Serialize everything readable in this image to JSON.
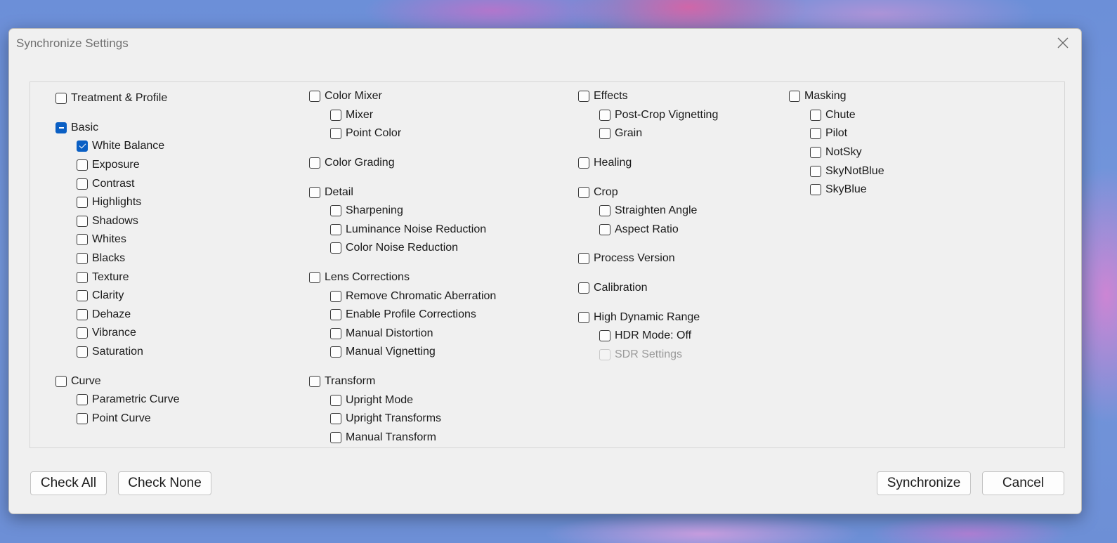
{
  "dialog": {
    "title": "Synchronize Settings",
    "close_icon": "close-icon"
  },
  "columns": [
    [
      {
        "label": "Treatment & Profile",
        "level": 0,
        "state": "unchecked"
      },
      {
        "gap": true
      },
      {
        "label": "Basic",
        "level": 0,
        "state": "mixed"
      },
      {
        "label": "White Balance",
        "level": 1,
        "state": "checked"
      },
      {
        "label": "Exposure",
        "level": 1,
        "state": "unchecked"
      },
      {
        "label": "Contrast",
        "level": 1,
        "state": "unchecked"
      },
      {
        "label": "Highlights",
        "level": 1,
        "state": "unchecked"
      },
      {
        "label": "Shadows",
        "level": 1,
        "state": "unchecked"
      },
      {
        "label": "Whites",
        "level": 1,
        "state": "unchecked"
      },
      {
        "label": "Blacks",
        "level": 1,
        "state": "unchecked"
      },
      {
        "label": "Texture",
        "level": 1,
        "state": "unchecked"
      },
      {
        "label": "Clarity",
        "level": 1,
        "state": "unchecked"
      },
      {
        "label": "Dehaze",
        "level": 1,
        "state": "unchecked"
      },
      {
        "label": "Vibrance",
        "level": 1,
        "state": "unchecked"
      },
      {
        "label": "Saturation",
        "level": 1,
        "state": "unchecked"
      },
      {
        "gap": true
      },
      {
        "label": "Curve",
        "level": 0,
        "state": "unchecked"
      },
      {
        "label": "Parametric Curve",
        "level": 1,
        "state": "unchecked"
      },
      {
        "label": "Point Curve",
        "level": 1,
        "state": "unchecked"
      }
    ],
    [
      {
        "label": "Color Mixer",
        "level": 0,
        "state": "unchecked"
      },
      {
        "label": "Mixer",
        "level": 1,
        "state": "unchecked"
      },
      {
        "label": "Point Color",
        "level": 1,
        "state": "unchecked"
      },
      {
        "gap": true
      },
      {
        "label": "Color Grading",
        "level": 0,
        "state": "unchecked"
      },
      {
        "gap": true
      },
      {
        "label": "Detail",
        "level": 0,
        "state": "unchecked"
      },
      {
        "label": "Sharpening",
        "level": 1,
        "state": "unchecked"
      },
      {
        "label": "Luminance Noise Reduction",
        "level": 1,
        "state": "unchecked"
      },
      {
        "label": "Color Noise Reduction",
        "level": 1,
        "state": "unchecked"
      },
      {
        "gap": true
      },
      {
        "label": "Lens Corrections",
        "level": 0,
        "state": "unchecked"
      },
      {
        "label": "Remove Chromatic Aberration",
        "level": 1,
        "state": "unchecked"
      },
      {
        "label": "Enable Profile Corrections",
        "level": 1,
        "state": "unchecked"
      },
      {
        "label": "Manual Distortion",
        "level": 1,
        "state": "unchecked"
      },
      {
        "label": "Manual Vignetting",
        "level": 1,
        "state": "unchecked"
      },
      {
        "gap": true
      },
      {
        "label": "Transform",
        "level": 0,
        "state": "unchecked"
      },
      {
        "label": "Upright Mode",
        "level": 1,
        "state": "unchecked"
      },
      {
        "label": "Upright Transforms",
        "level": 1,
        "state": "unchecked"
      },
      {
        "label": "Manual Transform",
        "level": 1,
        "state": "unchecked"
      }
    ],
    [
      {
        "label": "Effects",
        "level": 0,
        "state": "unchecked"
      },
      {
        "label": "Post-Crop Vignetting",
        "level": 1,
        "state": "unchecked"
      },
      {
        "label": "Grain",
        "level": 1,
        "state": "unchecked"
      },
      {
        "gap": true
      },
      {
        "label": "Healing",
        "level": 0,
        "state": "unchecked"
      },
      {
        "gap": true
      },
      {
        "label": "Crop",
        "level": 0,
        "state": "unchecked"
      },
      {
        "label": "Straighten Angle",
        "level": 1,
        "state": "unchecked"
      },
      {
        "label": "Aspect Ratio",
        "level": 1,
        "state": "unchecked"
      },
      {
        "gap": true
      },
      {
        "label": "Process Version",
        "level": 0,
        "state": "unchecked"
      },
      {
        "gap": true
      },
      {
        "label": "Calibration",
        "level": 0,
        "state": "unchecked"
      },
      {
        "gap": true
      },
      {
        "label": "High Dynamic Range",
        "level": 0,
        "state": "unchecked"
      },
      {
        "label": "HDR Mode: Off",
        "level": 1,
        "state": "unchecked"
      },
      {
        "label": "SDR Settings",
        "level": 1,
        "state": "disabled"
      }
    ],
    [
      {
        "label": "Masking",
        "level": 0,
        "state": "unchecked"
      },
      {
        "label": "Chute",
        "level": 1,
        "state": "unchecked"
      },
      {
        "label": "Pilot",
        "level": 1,
        "state": "unchecked"
      },
      {
        "label": "NotSky",
        "level": 1,
        "state": "unchecked"
      },
      {
        "label": "SkyNotBlue",
        "level": 1,
        "state": "unchecked"
      },
      {
        "label": "SkyBlue",
        "level": 1,
        "state": "unchecked"
      }
    ]
  ],
  "buttons": {
    "check_all": "Check All",
    "check_none": "Check None",
    "synchronize": "Synchronize",
    "cancel": "Cancel"
  },
  "colors": {
    "accent": "#0a5fc4",
    "dialog_bg": "#f0f0f0"
  }
}
